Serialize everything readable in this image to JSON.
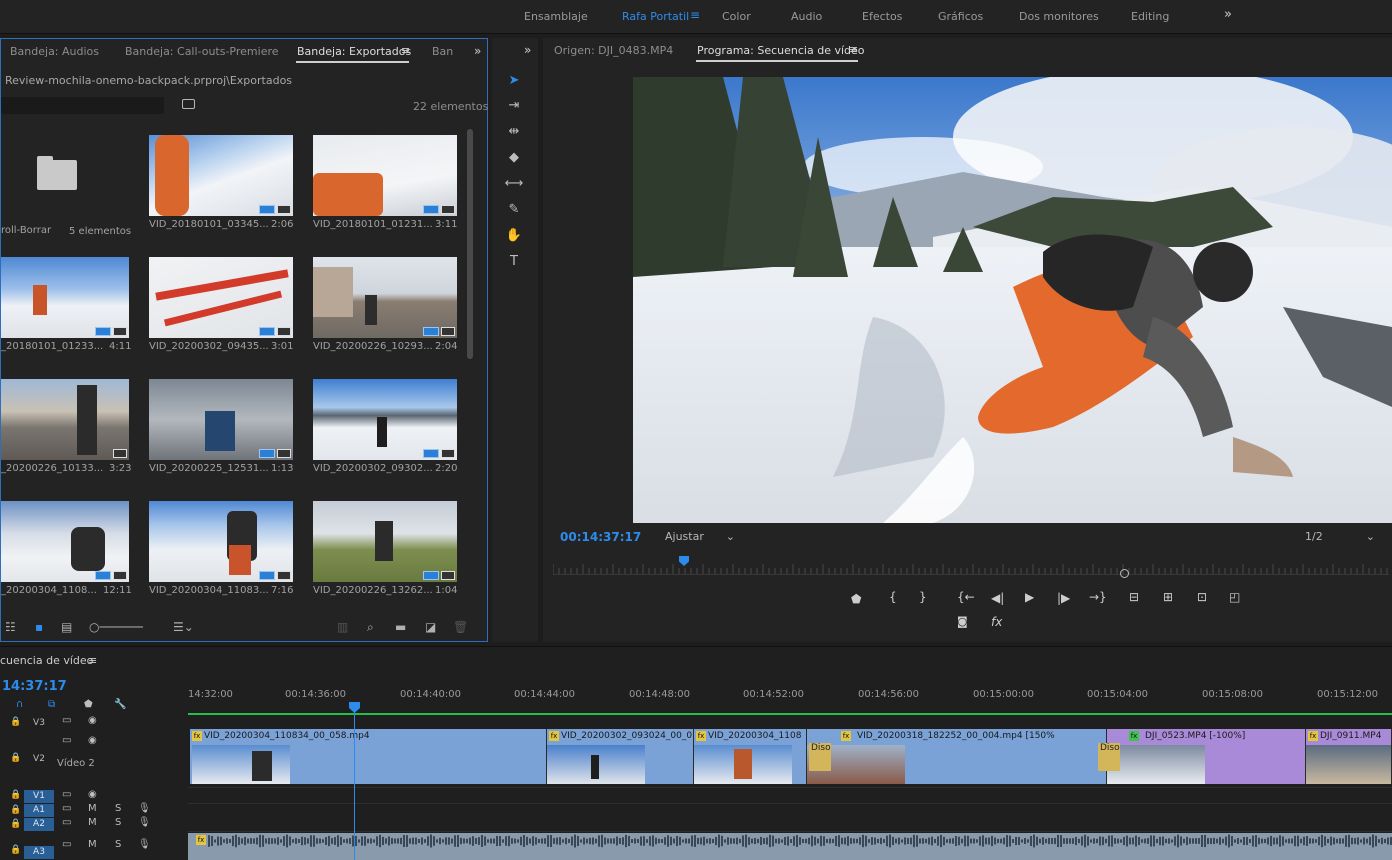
{
  "workspaces": {
    "items": [
      "Ensamblaje",
      "Rafa Portatil",
      "Color",
      "Audio",
      "Efectos",
      "Gráficos",
      "Dos monitores",
      "Editing"
    ],
    "active": "Rafa Portatil",
    "menu_icon": "≡",
    "overflow": "»"
  },
  "project": {
    "tabs": [
      "Bandeja: Audios",
      "Bandeja: Call-outs-Premiere",
      "Bandeja: Exportados",
      "Ban"
    ],
    "active_tab": "Bandeja: Exportados",
    "tab_menu_icon": "≡",
    "overflow": "»",
    "path": "Review-mochila-onemo-backpack.prproj\\Exportados",
    "item_count": "22 elementos",
    "search_placeholder": "",
    "folder": {
      "name": "roll-Borrar",
      "count": "5 elementos"
    },
    "clips": [
      {
        "name": "VID_20180101_03345...",
        "duration": "2:06"
      },
      {
        "name": "VID_20180101_01231...",
        "duration": "3:11"
      },
      {
        "name": "_20180101_01233...",
        "duration": "4:11"
      },
      {
        "name": "VID_20200302_09435...",
        "duration": "3:01"
      },
      {
        "name": "VID_20200226_10293...",
        "duration": "2:04"
      },
      {
        "name": "_20200226_10133...",
        "duration": "3:23"
      },
      {
        "name": "VID_20200225_12531...",
        "duration": "1:13"
      },
      {
        "name": "VID_20200302_09302...",
        "duration": "2:20"
      },
      {
        "name": "_20200304_1108...",
        "duration": "12:11"
      },
      {
        "name": "VID_20200304_11083...",
        "duration": "7:16"
      },
      {
        "name": "VID_20200226_13262...",
        "duration": "1:04"
      }
    ]
  },
  "monitor": {
    "source_tab": "Origen: DJI_0483.MP4",
    "program_tab": "Programa: Secuencia de vídeo",
    "tab_menu_icon": "≡",
    "overflow": "»",
    "timecode": "00:14:37:17",
    "fit": "Ajustar",
    "resolution": "1/2",
    "controls": {
      "marker": "⬟",
      "in": "{",
      "out": "}",
      "go_in": "{←",
      "step_back": "◀|",
      "play": "▶",
      "step_fwd": "|▶",
      "go_out": "→}",
      "lift": "⊟",
      "extract": "⊞",
      "insert": "⊡",
      "overwrite": "◰",
      "camera": "📷",
      "fx": "fx"
    },
    "playhead_fraction": 0.156
  },
  "tools": [
    "selection-tool",
    "track-select-tool",
    "ripple-edit-tool",
    "razor-tool",
    "slip-tool",
    "pen-tool",
    "hand-tool",
    "type-tool"
  ],
  "timeline": {
    "title": "cuencia de vídeo",
    "title_menu_icon": "≡",
    "timecode": "14:37:17",
    "ticks": [
      "14:32:00",
      "00:14:36:00",
      "00:14:40:00",
      "00:14:44:00",
      "00:14:48:00",
      "00:14:52:00",
      "00:14:56:00",
      "00:15:00:00",
      "00:15:04:00",
      "00:15:08:00",
      "00:15:12:00"
    ],
    "tracks": {
      "v3": "V3",
      "v2": "V2",
      "v2_name": "Vídeo 2",
      "v1": "V1",
      "a1": "A1",
      "a2": "A2",
      "a3": "A3",
      "mute": "M",
      "solo": "S"
    },
    "clips": [
      {
        "label": "VID_20200304_110834_00_058.mp4",
        "color": "blue"
      },
      {
        "label": "VID_20200302_093024_00_0",
        "color": "blue"
      },
      {
        "label": "VID_20200304_1108",
        "color": "blue"
      },
      {
        "label": "VID_20200318_182252_00_004.mp4 [150%",
        "color": "blue"
      },
      {
        "label": "DJI_0523.MP4 [-100%]",
        "color": "purple"
      },
      {
        "label": "DJI_0911.MP4",
        "color": "purple"
      }
    ],
    "transitions": [
      "Diso",
      "Diso"
    ],
    "fx_badge": "fx"
  },
  "colors": {
    "accent": "#2d8ceb",
    "work_area": "#22c04a",
    "clip_blue": "#7aa2d6",
    "clip_purple": "#a98ad8"
  }
}
